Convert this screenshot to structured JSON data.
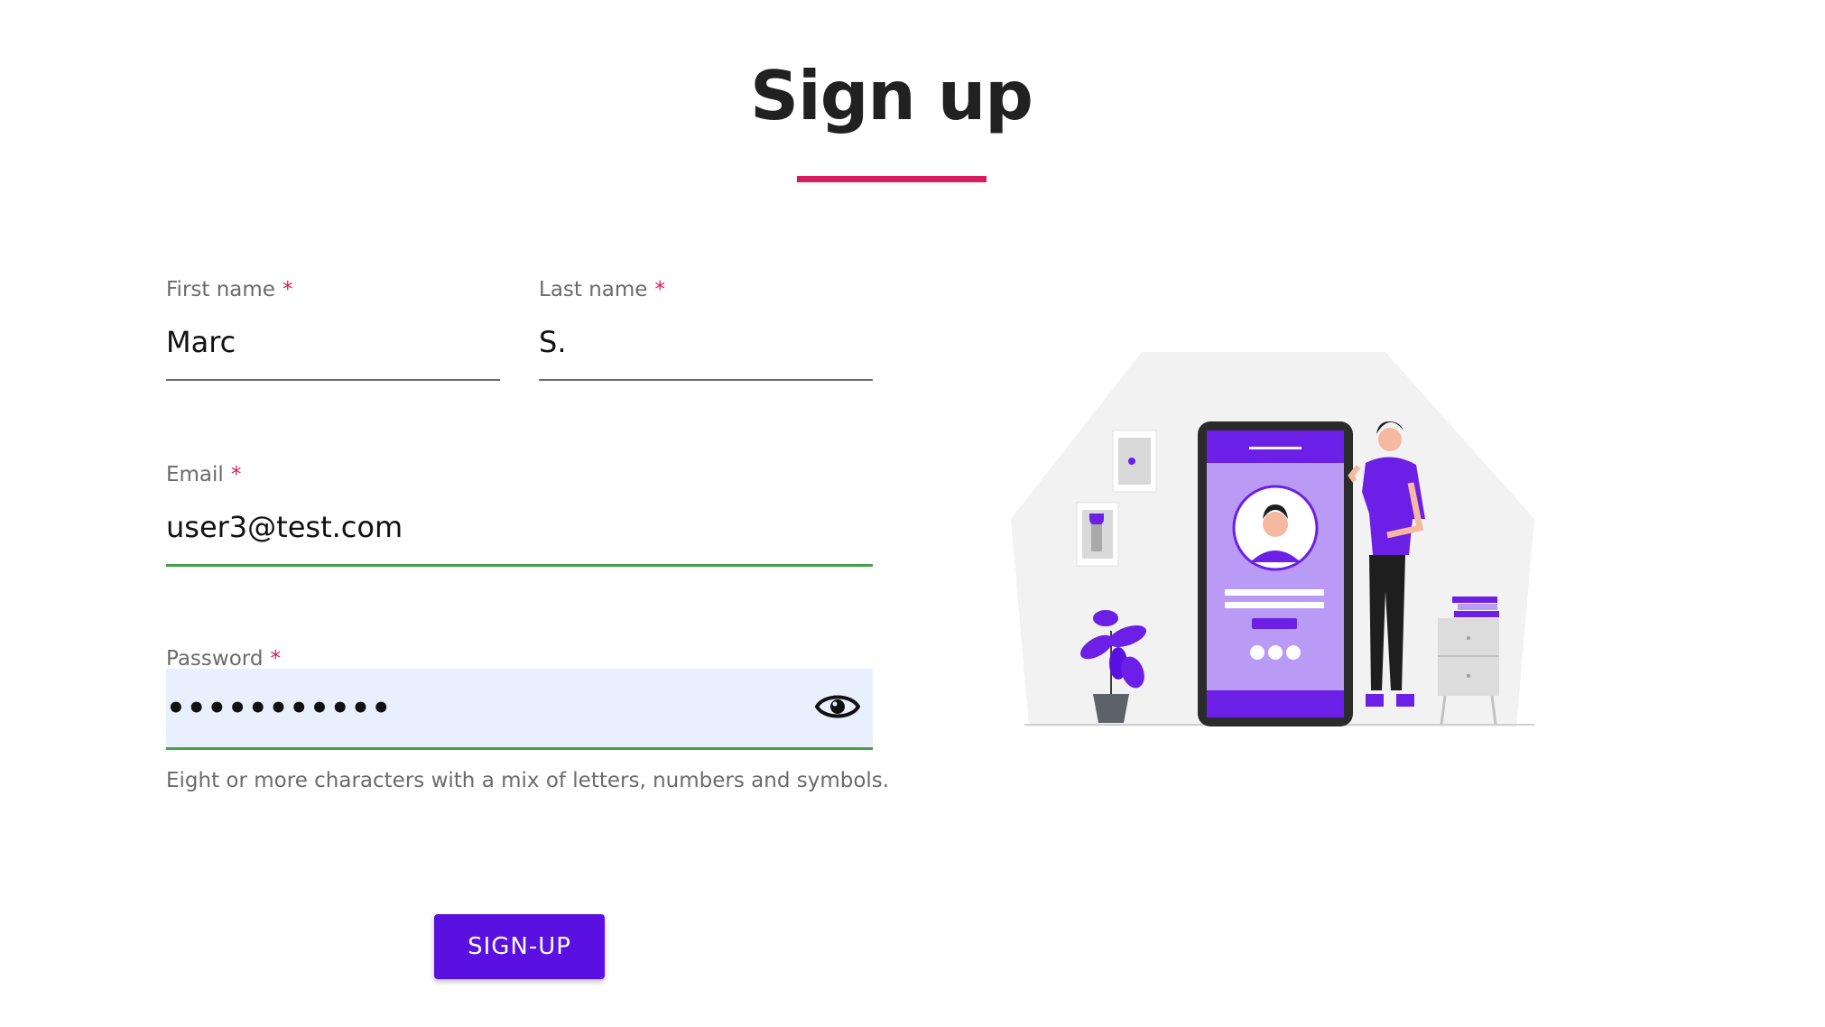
{
  "page": {
    "title": "Sign up"
  },
  "form": {
    "first_name": {
      "label": "First name",
      "required_mark": "*",
      "value": "Marc"
    },
    "last_name": {
      "label": "Last name",
      "required_mark": "*",
      "value": "S."
    },
    "email": {
      "label": "Email",
      "required_mark": "*",
      "value": "user3@test.com"
    },
    "password": {
      "label": "Password",
      "required_mark": "*",
      "masked_value": "•••••••••••",
      "helper": "Eight or more characters with a mix of letters, numbers and symbols."
    },
    "submit_label": "SIGN-UP"
  },
  "colors": {
    "accent_rule": "#d81b60",
    "button": "#5a10e0",
    "valid_underline": "#43a047",
    "autofill_bg": "#e8f0fe",
    "illustration_purple": "#6c1fe6"
  },
  "icons": {
    "password_toggle": "eye-icon"
  }
}
